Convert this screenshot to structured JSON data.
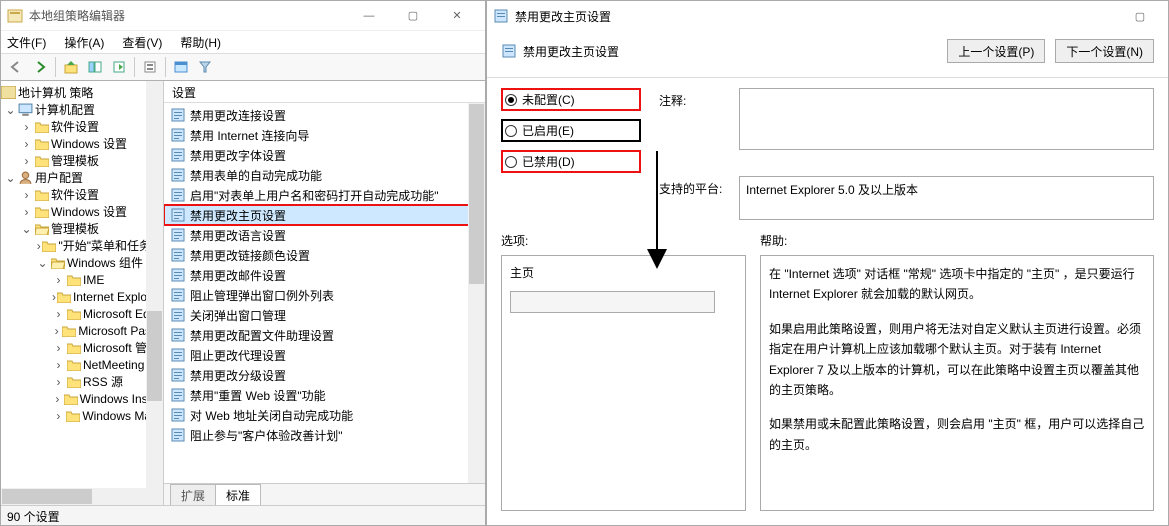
{
  "gpedit": {
    "title": "本地组策略编辑器",
    "menus": {
      "file": "文件(F)",
      "action": "操作(A)",
      "view": "查看(V)",
      "help": "帮助(H)"
    },
    "tree": {
      "root": "地计算机 策略",
      "computer_config": "计算机配置",
      "cc_software": "软件设置",
      "cc_windows": "Windows 设置",
      "cc_templates": "管理模板",
      "user_config": "用户配置",
      "uc_software": "软件设置",
      "uc_windows": "Windows 设置",
      "uc_templates": "管理模板",
      "start_menu": "\"开始\"菜单和任务…",
      "win_components": "Windows 组件",
      "ime": "IME",
      "ie": "Internet Explor…",
      "edge": "Microsoft Ed…",
      "passport": "Microsoft Pas…",
      "ms_mgmt": "Microsoft 管…",
      "netmeeting": "NetMeeting",
      "rss": "RSS 源",
      "win_inst": "Windows Inst…",
      "win_mail": "Windows Ma…"
    },
    "list": {
      "header": "设置",
      "items": [
        "禁用更改连接设置",
        "禁用 Internet 连接向导",
        "禁用更改字体设置",
        "禁用表单的自动完成功能",
        "启用\"对表单上用户名和密码打开自动完成功能\"",
        "禁用更改主页设置",
        "禁用更改语言设置",
        "禁用更改链接颜色设置",
        "禁用更改邮件设置",
        "阻止管理弹出窗口例外列表",
        "关闭弹出窗口管理",
        "禁用更改配置文件助理设置",
        "阻止更改代理设置",
        "禁用更改分级设置",
        "禁用\"重置 Web 设置\"功能",
        "对 Web 地址关闭自动完成功能",
        "阻止参与\"客户体验改善计划\""
      ],
      "tabs": {
        "extended": "扩展",
        "standard": "标准"
      }
    },
    "status": "90 个设置"
  },
  "policy": {
    "title": "禁用更改主页设置",
    "heading": "禁用更改主页设置",
    "nav": {
      "prev": "上一个设置(P)",
      "next": "下一个设置(N)"
    },
    "radios": {
      "not_configured": "未配置(C)",
      "enabled": "已启用(E)",
      "disabled": "已禁用(D)"
    },
    "labels": {
      "comment": "注释:",
      "platform": "支持的平台:",
      "options": "选项:",
      "help": "帮助:"
    },
    "platform_text": "Internet Explorer 5.0 及以上版本",
    "options": {
      "homepage_label": "主页"
    },
    "help": {
      "p1": "在 \"Internet 选项\" 对话框 \"常规\" 选项卡中指定的 \"主页\" ，是只要运行 Internet Explorer 就会加载的默认网页。",
      "p2": "如果启用此策略设置，则用户将无法对自定义默认主页进行设置。必须指定在用户计算机上应该加载哪个默认主页。对于装有 Internet Explorer 7 及以上版本的计算机，可以在此策略中设置主页以覆盖其他的主页策略。",
      "p3": "如果禁用或未配置此策略设置，则会启用 \"主页\" 框，用户可以选择自己的主页。"
    }
  }
}
